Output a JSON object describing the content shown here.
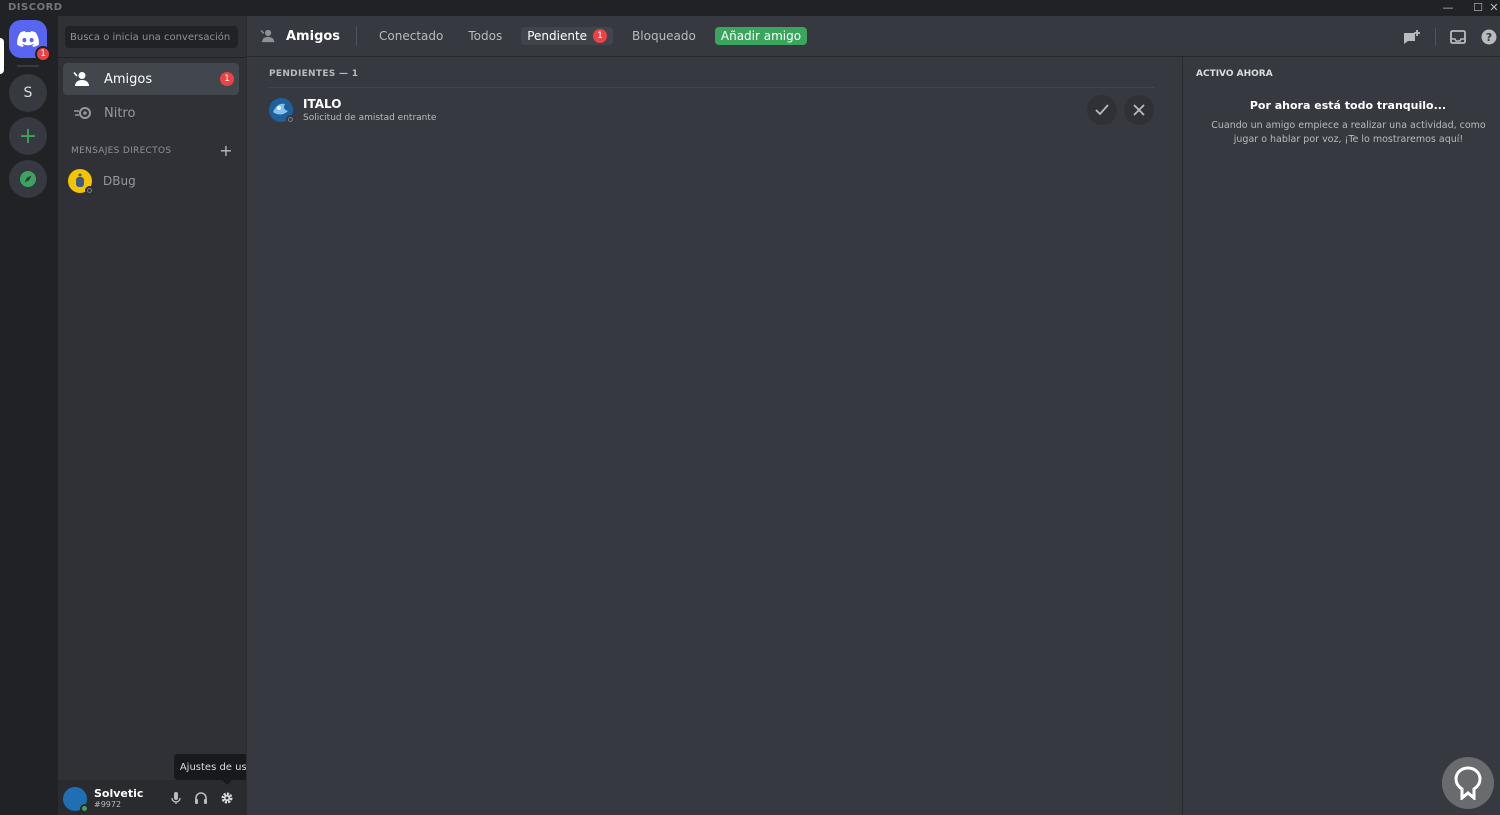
{
  "window": {
    "brand": "DISCORD",
    "min": "—",
    "max": "☐",
    "close": "✕"
  },
  "rail": {
    "home_badge": "1",
    "server_s": "S",
    "add": "+"
  },
  "sidebar": {
    "search_placeholder": "Busca o inicia una conversación",
    "items": [
      {
        "label": "Amigos",
        "badge": "1"
      },
      {
        "label": "Nitro"
      }
    ],
    "dm_header": "MENSAJES DIRECTOS",
    "dm_add": "+",
    "dms": [
      {
        "name": "DBug"
      }
    ]
  },
  "user": {
    "name": "Solvetic",
    "tag": "#9972"
  },
  "tooltip": "Ajustes de usuario",
  "header": {
    "title": "Amigos",
    "tabs": [
      {
        "label": "Conectado"
      },
      {
        "label": "Todos"
      },
      {
        "label": "Pendiente",
        "badge": "1"
      },
      {
        "label": "Bloqueado"
      }
    ],
    "add_friend": "Añadir amigo"
  },
  "pending": {
    "section": "PENDIENTES — 1",
    "rows": [
      {
        "name": "ITALO",
        "subtitle": "Solicitud de amistad entrante"
      }
    ]
  },
  "active_now": {
    "title": "ACTIVO AHORA",
    "heading": "Por ahora está todo tranquilo...",
    "body": "Cuando un amigo empiece a realizar una actividad, como jugar o hablar por voz, ¡Te lo mostraremos aquí!"
  },
  "colors": {
    "accent": "#5865f2",
    "green": "#3ba55d",
    "red": "#ed4245",
    "bg_main": "#36393f",
    "bg_sidebar": "#2f3136"
  }
}
